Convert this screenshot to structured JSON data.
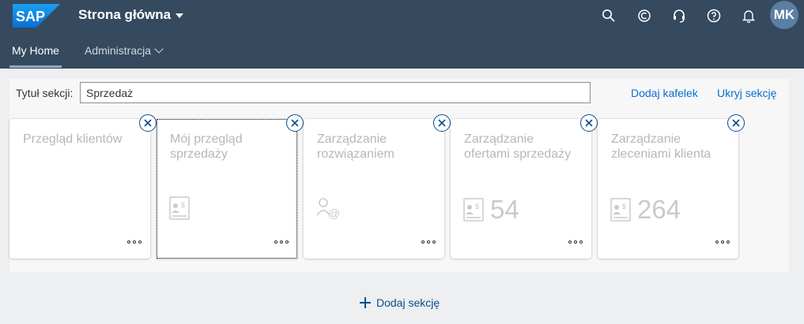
{
  "shell": {
    "logo_text": "SAP",
    "title": "Strona główna",
    "icons": [
      "search-icon",
      "copilot-icon",
      "headset-icon",
      "help-icon",
      "notification-icon"
    ],
    "avatar_initials": "MK"
  },
  "nav": {
    "tabs": [
      {
        "label": "My Home",
        "active": true
      },
      {
        "label": "Administracja",
        "active": false
      }
    ]
  },
  "section": {
    "title_label": "Tytuł sekcji:",
    "title_value": "Sprzedaż",
    "add_tile_label": "Dodaj kafelek",
    "hide_section_label": "Ukryj sekcję"
  },
  "tiles": [
    {
      "title": "Przegląd klientów",
      "icon": "",
      "number": ""
    },
    {
      "title": "Mój przegląd sprzedaży",
      "icon": "sales-document-icon",
      "number": ""
    },
    {
      "title": "Zarządzanie rozwiązaniem",
      "icon": "customer-contact-icon",
      "number": ""
    },
    {
      "title": "Zarządzanie ofertami sprzedaży",
      "icon": "sales-document-icon",
      "number": "54"
    },
    {
      "title": "Zarządzanie zleceniami klienta",
      "icon": "sales-document-icon",
      "number": "264"
    }
  ],
  "footer": {
    "add_section_label": "Dodaj sekcję"
  },
  "colors": {
    "shell_bg": "#354a5f",
    "link": "#0a6ed1",
    "remove_border": "#0a4d8f",
    "page_bg": "#edeff0"
  }
}
